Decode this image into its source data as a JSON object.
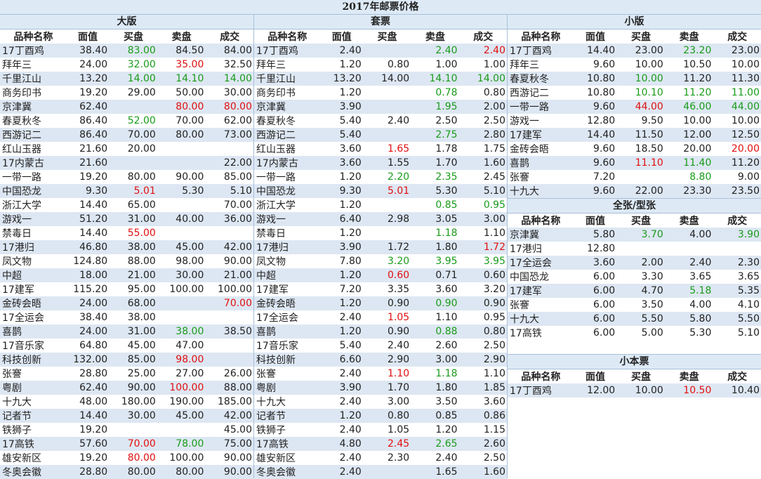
{
  "title": "2017年邮票价格",
  "columns": [
    "品种名称",
    "面值",
    "买盘",
    "卖盘",
    "成交"
  ],
  "big": {
    "label": "大版",
    "rows": [
      [
        "17丁酉鸡",
        "38.40",
        "83.00",
        "84.50",
        "84.00"
      ],
      [
        "拜年三",
        "24.00",
        "32.00",
        "35.00",
        "32.50"
      ],
      [
        "千里江山",
        "13.20",
        "14.00",
        "14.10",
        "14.00"
      ],
      [
        "商务印书",
        "19.20",
        "29.00",
        "50.00",
        "30.00"
      ],
      [
        "京津冀",
        "62.40",
        "",
        "80.00",
        "80.00"
      ],
      [
        "春夏秋冬",
        "86.40",
        "52.00",
        "70.00",
        "62.00"
      ],
      [
        "西游记二",
        "86.40",
        "70.00",
        "80.00",
        "73.00"
      ],
      [
        "红山玉器",
        "21.60",
        "20.00",
        "",
        ""
      ],
      [
        "17内蒙古",
        "21.60",
        "",
        "",
        "22.00"
      ],
      [
        "一带一路",
        "19.20",
        "80.00",
        "90.00",
        "85.00"
      ],
      [
        "中国恐龙",
        "9.30",
        "5.01",
        "5.30",
        "5.10"
      ],
      [
        "浙江大学",
        "14.40",
        "65.00",
        "",
        "70.00"
      ],
      [
        "游戏一",
        "51.20",
        "31.00",
        "40.00",
        "36.00"
      ],
      [
        "禁毒日",
        "14.40",
        "55.00",
        "",
        ""
      ],
      [
        "17港归",
        "46.80",
        "38.00",
        "45.00",
        "42.00"
      ],
      [
        "凤文物",
        "124.80",
        "88.00",
        "98.00",
        "90.00"
      ],
      [
        "中超",
        "18.00",
        "21.00",
        "30.00",
        "21.00"
      ],
      [
        "17建军",
        "115.20",
        "95.00",
        "100.00",
        "100.00"
      ],
      [
        "金砖会晤",
        "24.00",
        "68.00",
        "",
        "70.00"
      ],
      [
        "17全运会",
        "38.40",
        "38.00",
        "",
        ""
      ],
      [
        "喜鹊",
        "24.00",
        "31.00",
        "38.00",
        "38.50"
      ],
      [
        "17音乐家",
        "64.80",
        "45.00",
        "47.00",
        ""
      ],
      [
        "科技创新",
        "132.00",
        "85.00",
        "98.00",
        ""
      ],
      [
        "张謇",
        "28.80",
        "25.00",
        "27.00",
        "26.00"
      ],
      [
        "粤剧",
        "62.40",
        "90.00",
        "100.00",
        "88.00"
      ],
      [
        "十九大",
        "48.00",
        "180.00",
        "190.00",
        "185.00"
      ],
      [
        "记者节",
        "14.40",
        "30.00",
        "45.00",
        "42.00"
      ],
      [
        "铁狮子",
        "19.20",
        "",
        "",
        "45.00"
      ],
      [
        "17高铁",
        "57.60",
        "70.00",
        "78.00",
        "75.00"
      ],
      [
        "雄安新区",
        "19.20",
        "80.00",
        "100.00",
        "90.00"
      ],
      [
        "冬奥会徽",
        "28.80",
        "80.00",
        "80.00",
        "90.00"
      ]
    ],
    "colors": {
      "0-2": "g",
      "1-2": "g",
      "1-3": "r",
      "2-2": "g",
      "2-3": "g",
      "2-4": "g",
      "4-3": "r",
      "4-4": "r",
      "5-2": "g",
      "10-2": "r",
      "13-2": "r",
      "18-4": "r",
      "20-3": "g",
      "22-3": "r",
      "24-3": "r",
      "28-2": "r",
      "28-3": "g",
      "29-2": "r"
    }
  },
  "set": {
    "label": "套票",
    "rows": [
      [
        "17丁酉鸡",
        "2.40",
        "",
        "2.40",
        "2.40"
      ],
      [
        "拜年三",
        "1.20",
        "0.80",
        "1.00",
        "1.00"
      ],
      [
        "千里江山",
        "13.20",
        "14.00",
        "14.10",
        "14.00"
      ],
      [
        "商务印书",
        "1.20",
        "",
        "0.78",
        "0.80"
      ],
      [
        "京津冀",
        "3.90",
        "",
        "1.95",
        "2.00"
      ],
      [
        "春夏秋冬",
        "5.40",
        "2.40",
        "2.50",
        "2.50"
      ],
      [
        "西游记二",
        "5.40",
        "",
        "2.75",
        "2.80"
      ],
      [
        "红山玉器",
        "3.60",
        "1.65",
        "1.78",
        "1.75"
      ],
      [
        "17内蒙古",
        "3.60",
        "1.55",
        "1.70",
        "1.60"
      ],
      [
        "一带一路",
        "1.20",
        "2.20",
        "2.35",
        "2.45"
      ],
      [
        "中国恐龙",
        "9.30",
        "5.01",
        "5.30",
        "5.10"
      ],
      [
        "浙江大学",
        "1.20",
        "",
        "0.85",
        "0.95"
      ],
      [
        "游戏一",
        "6.40",
        "2.98",
        "3.05",
        "3.00"
      ],
      [
        "禁毒日",
        "1.20",
        "",
        "1.18",
        "1.10"
      ],
      [
        "17港归",
        "3.90",
        "1.72",
        "1.80",
        "1.72"
      ],
      [
        "凤文物",
        "7.80",
        "3.20",
        "3.95",
        "3.95"
      ],
      [
        "中超",
        "1.20",
        "0.60",
        "0.71",
        "0.60"
      ],
      [
        "17建军",
        "7.20",
        "3.35",
        "3.60",
        "3.20"
      ],
      [
        "金砖会晤",
        "1.20",
        "0.90",
        "0.90",
        "0.90"
      ],
      [
        "17全运会",
        "2.40",
        "1.05",
        "1.10",
        "0.95"
      ],
      [
        "喜鹊",
        "1.20",
        "0.90",
        "0.88",
        "0.80"
      ],
      [
        "17音乐家",
        "5.40",
        "2.40",
        "2.60",
        "2.50"
      ],
      [
        "科技创新",
        "6.60",
        "2.90",
        "3.00",
        "2.90"
      ],
      [
        "张謇",
        "2.40",
        "1.10",
        "1.18",
        "1.10"
      ],
      [
        "粤剧",
        "3.90",
        "1.70",
        "1.80",
        "1.85"
      ],
      [
        "十九大",
        "2.40",
        "3.00",
        "3.50",
        "3.60"
      ],
      [
        "记者节",
        "1.20",
        "0.80",
        "0.85",
        "0.86"
      ],
      [
        "铁狮子",
        "2.40",
        "1.05",
        "1.20",
        "1.15"
      ],
      [
        "17高铁",
        "4.80",
        "2.45",
        "2.65",
        "2.60"
      ],
      [
        "雄安新区",
        "2.40",
        "2.30",
        "2.40",
        "2.50"
      ],
      [
        "冬奥会徽",
        "2.40",
        "",
        "1.65",
        "1.60"
      ]
    ],
    "colors": {
      "0-3": "g",
      "0-4": "r",
      "2-3": "g",
      "2-4": "g",
      "3-3": "g",
      "4-3": "g",
      "6-3": "g",
      "7-2": "r",
      "9-2": "g",
      "9-3": "g",
      "10-2": "r",
      "11-3": "g",
      "11-4": "g",
      "13-3": "g",
      "14-4": "r",
      "15-2": "g",
      "15-3": "g",
      "15-4": "g",
      "16-2": "r",
      "18-3": "g",
      "19-2": "r",
      "20-3": "g",
      "23-2": "r",
      "23-3": "g",
      "28-2": "r",
      "28-3": "g"
    }
  },
  "small": {
    "label": "小版",
    "rows": [
      [
        "17丁酉鸡",
        "14.40",
        "23.00",
        "23.20",
        "23.00"
      ],
      [
        "拜年三",
        "9.60",
        "10.00",
        "10.50",
        "10.00"
      ],
      [
        "春夏秋冬",
        "10.80",
        "10.00",
        "11.20",
        "11.30"
      ],
      [
        "西游记二",
        "10.80",
        "10.10",
        "11.20",
        "11.00"
      ],
      [
        "一带一路",
        "9.60",
        "44.00",
        "46.00",
        "44.00"
      ],
      [
        "游戏一",
        "12.80",
        "9.50",
        "10.00",
        "10.00"
      ],
      [
        "17建军",
        "14.40",
        "11.50",
        "12.00",
        "12.50"
      ],
      [
        "金砖会晤",
        "9.60",
        "18.50",
        "20.00",
        "20.00"
      ],
      [
        "喜鹊",
        "9.60",
        "11.10",
        "11.40",
        "11.20"
      ],
      [
        "张謇",
        "7.20",
        "",
        "8.80",
        "9.00"
      ],
      [
        "十九大",
        "9.60",
        "22.00",
        "23.30",
        "23.50"
      ]
    ],
    "colors": {
      "0-3": "g",
      "2-2": "g",
      "3-2": "g",
      "3-3": "g",
      "3-4": "g",
      "4-2": "r",
      "4-3": "g",
      "4-4": "g",
      "7-4": "r",
      "8-2": "r",
      "8-3": "g",
      "9-3": "g"
    }
  },
  "sheet": {
    "label": "全张/型张",
    "rows": [
      [
        "京津冀",
        "5.80",
        "3.70",
        "4.00",
        "3.90"
      ],
      [
        "17港归",
        "12.80",
        "",
        "",
        ""
      ],
      [
        "17全运会",
        "3.60",
        "2.00",
        "2.40",
        "2.30"
      ],
      [
        "中国恐龙",
        "6.00",
        "3.30",
        "3.65",
        "3.65"
      ],
      [
        "17建军",
        "6.00",
        "4.70",
        "5.18",
        "5.35"
      ],
      [
        "张謇",
        "6.00",
        "3.50",
        "4.00",
        "4.10"
      ],
      [
        "十九大",
        "6.00",
        "5.50",
        "5.80",
        "5.50"
      ],
      [
        "17高铁",
        "6.00",
        "5.00",
        "5.30",
        "5.10"
      ]
    ],
    "colors": {
      "0-2": "g",
      "0-4": "g",
      "4-3": "g"
    }
  },
  "booklet": {
    "label": "小本票",
    "rows": [
      [
        "17丁酉鸡",
        "12.00",
        "10.00",
        "10.50",
        "10.40"
      ]
    ],
    "colors": {
      "0-3": "r"
    }
  }
}
